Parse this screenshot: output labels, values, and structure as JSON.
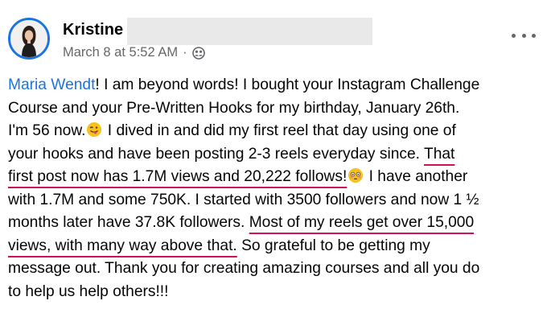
{
  "post": {
    "author": "Kristine",
    "date": "March 8 at 5:52 AM",
    "separator": "·",
    "privacy_icon": "friends-globe-icon",
    "more_icon": "more-options-icon"
  },
  "colors": {
    "mention": "#1b74e4",
    "underline": "#d0105a",
    "meta": "#65676b"
  },
  "body": {
    "l1_mention": "Maria Wendt",
    "l1_text": "! I am beyond words! I bought your Instagram Challenge",
    "l2": "Course and your Pre-Written Hooks for my birthday, January 26th.",
    "l3_a": "I'm 56 now.",
    "l3_b": " I dived in and did my first reel that day using one of",
    "l4_a": "your hooks and have been posting 2-3 reels everyday since. ",
    "l4_u": "That",
    "l5_u": "first post now has 1.7M views and 20,222 follows!",
    "l5_b": " I have another",
    "l6": "with 1.7M and some 750K. I started with 3500 followers and now 1 ½",
    "l7_a": "months later have 37.8K followers. ",
    "l7_u": "Most of my reels get over 15,000",
    "l8_u": "views, with many way above that.",
    "l8_b": " So grateful to be getting my",
    "l9": "message out. Thank you for creating amazing courses and all you do",
    "l10": "to help us help others!!!",
    "emoji_1": "winking-tongue-emoji",
    "emoji_2": "flushed-face-emoji"
  }
}
